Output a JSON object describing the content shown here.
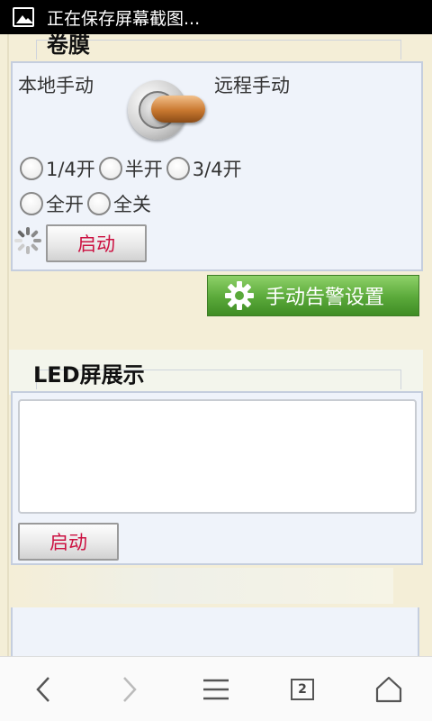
{
  "status_bar": {
    "icon": "image-icon",
    "text": "正在保存屏幕截图..."
  },
  "film_section": {
    "title": "卷膜",
    "local_label": "本地手动",
    "remote_label": "远程手动",
    "toggle_state": "remote",
    "radio_options": [
      "1/4开",
      "半开",
      "3/4开",
      "全开",
      "全关"
    ],
    "selected_option": null,
    "start_button": "启动"
  },
  "alarm_button": {
    "icon": "gear-icon",
    "label": "手动告警设置"
  },
  "led_section": {
    "title": "LED屏展示",
    "text_value": "",
    "start_button": "启动"
  },
  "nav": {
    "back_icon": "back-chevron-icon",
    "forward_icon": "forward-chevron-icon",
    "menu_icon": "menu-icon",
    "tab_count": "2",
    "home_icon": "home-icon"
  },
  "colors": {
    "page_background": "#f4eed7",
    "panel_background": "#eff3fa",
    "button_text": "#cc1141",
    "alarm_button": "#5aa93a"
  }
}
